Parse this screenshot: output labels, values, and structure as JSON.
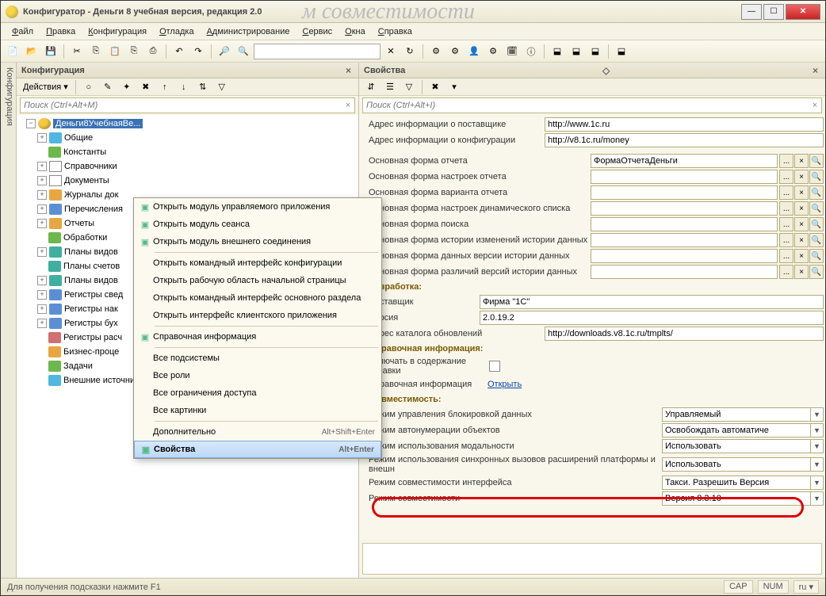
{
  "window": {
    "title": "Конфигуратор - Деньги 8 учебная версия, редакция 2.0",
    "ghost": "м совместимости"
  },
  "menubar": [
    "Файл",
    "Правка",
    "Конфигурация",
    "Отладка",
    "Администрирование",
    "Сервис",
    "Окна",
    "Справка"
  ],
  "leftPane": {
    "title": "Конфигурация",
    "actions": "Действия",
    "searchPlaceholder": "Поиск (Ctrl+Alt+M)"
  },
  "tree": {
    "root": "Деньги8УчебнаяВе...",
    "items": [
      {
        "label": "Общие",
        "icon": "ic-cyan",
        "exp": true
      },
      {
        "label": "Константы",
        "icon": "ic-green",
        "exp": false
      },
      {
        "label": "Справочники",
        "icon": "ic-doc",
        "exp": true
      },
      {
        "label": "Документы",
        "icon": "ic-doc",
        "exp": true
      },
      {
        "label": "Журналы док",
        "icon": "ic-orange",
        "exp": true
      },
      {
        "label": "Перечисления",
        "icon": "ic-blue",
        "exp": true
      },
      {
        "label": "Отчеты",
        "icon": "ic-orange",
        "exp": true
      },
      {
        "label": "Обработки",
        "icon": "ic-green",
        "exp": false
      },
      {
        "label": "Планы видов",
        "icon": "ic-teal",
        "exp": true
      },
      {
        "label": "Планы счетов",
        "icon": "ic-teal",
        "exp": false
      },
      {
        "label": "Планы видов",
        "icon": "ic-teal",
        "exp": true
      },
      {
        "label": "Регистры свед",
        "icon": "ic-blue",
        "exp": true
      },
      {
        "label": "Регистры нак",
        "icon": "ic-blue",
        "exp": true
      },
      {
        "label": "Регистры бух",
        "icon": "ic-blue",
        "exp": true
      },
      {
        "label": "Регистры расч",
        "icon": "ic-red",
        "exp": false
      },
      {
        "label": "Бизнес-проце",
        "icon": "ic-orange",
        "exp": false
      },
      {
        "label": "Задачи",
        "icon": "ic-green",
        "exp": false
      },
      {
        "label": "Внешние источники данных",
        "icon": "ic-cyan",
        "exp": false
      }
    ]
  },
  "ctx": {
    "items": [
      {
        "label": "Открыть модуль управляемого приложения",
        "icon": true
      },
      {
        "label": "Открыть модуль сеанса",
        "icon": true
      },
      {
        "label": "Открыть модуль внешнего соединения",
        "icon": true
      },
      {
        "sep": true
      },
      {
        "label": "Открыть командный интерфейс конфигурации"
      },
      {
        "label": "Открыть рабочую область начальной страницы"
      },
      {
        "label": "Открыть командный интерфейс основного раздела"
      },
      {
        "label": "Открыть интерфейс клиентского приложения"
      },
      {
        "sep": true
      },
      {
        "label": "Справочная информация",
        "icon": true
      },
      {
        "sep": true
      },
      {
        "label": "Все подсистемы"
      },
      {
        "label": "Все роли"
      },
      {
        "label": "Все ограничения доступа"
      },
      {
        "label": "Все картинки"
      },
      {
        "sep": true
      },
      {
        "label": "Дополнительно",
        "short": "Alt+Shift+Enter"
      },
      {
        "label": "Свойства",
        "short": "Alt+Enter",
        "hl": true,
        "icon": true
      }
    ]
  },
  "rightPane": {
    "title": "Свойства",
    "searchPlaceholder": "Поиск (Ctrl+Alt+I)"
  },
  "props": {
    "supplierInfoAddr": {
      "label": "Адрес информации о поставщике",
      "value": "http://www.1c.ru"
    },
    "configInfoAddr": {
      "label": "Адрес информации о конфигурации",
      "value": "http://v8.1c.ru/money"
    },
    "mainReportForm": {
      "label": "Основная форма отчета",
      "value": "ФормаОтчетаДеньги"
    },
    "mainSettingsForm": {
      "label": "Основная форма настроек отчета",
      "value": ""
    },
    "mainVariantForm": {
      "label": "Основная форма варианта отчета",
      "value": ""
    },
    "mainDynListForm": {
      "label": "Основная форма настроек динамического списка",
      "value": ""
    },
    "mainSearchForm": {
      "label": "Основная форма поиска",
      "value": ""
    },
    "mainHistoryChangesForm": {
      "label": "Основная форма истории изменений истории данных",
      "value": ""
    },
    "mainHistoryVersionForm": {
      "label": "Основная форма данных версии истории данных",
      "value": ""
    },
    "mainHistoryDiffForm": {
      "label": "Основная форма различий версий истории данных",
      "value": ""
    },
    "sectionDev": "Разработка:",
    "supplier": {
      "label": "Поставщик",
      "value": "Фирма \"1С\""
    },
    "version": {
      "label": "Версия",
      "value": "2.0.19.2"
    },
    "updateCatalog": {
      "label": "Адрес каталога обновлений",
      "value": "http://downloads.v8.1c.ru/tmplts/"
    },
    "sectionHelp": "Справочная информация:",
    "includeHelp": {
      "label": "Включать в содержание справки"
    },
    "helpInfo": {
      "label": "Справочная информация",
      "value": "Открыть"
    },
    "sectionCompat": "Совместимость:",
    "lockMode": {
      "label": "Режим управления блокировкой данных",
      "value": "Управляемый"
    },
    "autonum": {
      "label": "Режим автонумерации объектов",
      "value": "Освобождать автоматиче"
    },
    "modality": {
      "label": "Режим использования модальности",
      "value": "Использовать"
    },
    "sync": {
      "label": "Режим использования синхронных вызовов расширений платформы и внешн",
      "value": "Использовать"
    },
    "uiCompat": {
      "label": "Режим совместимости интерфейса",
      "value": "Такси. Разрешить Версия"
    },
    "compat": {
      "label": "Режим совместимости",
      "value": "Версия 8.3.10"
    }
  },
  "status": {
    "hint": "Для получения подсказки нажмите F1",
    "cap": "CAP",
    "num": "NUM",
    "lang": "ru"
  },
  "sideTab": "Конфигурация"
}
